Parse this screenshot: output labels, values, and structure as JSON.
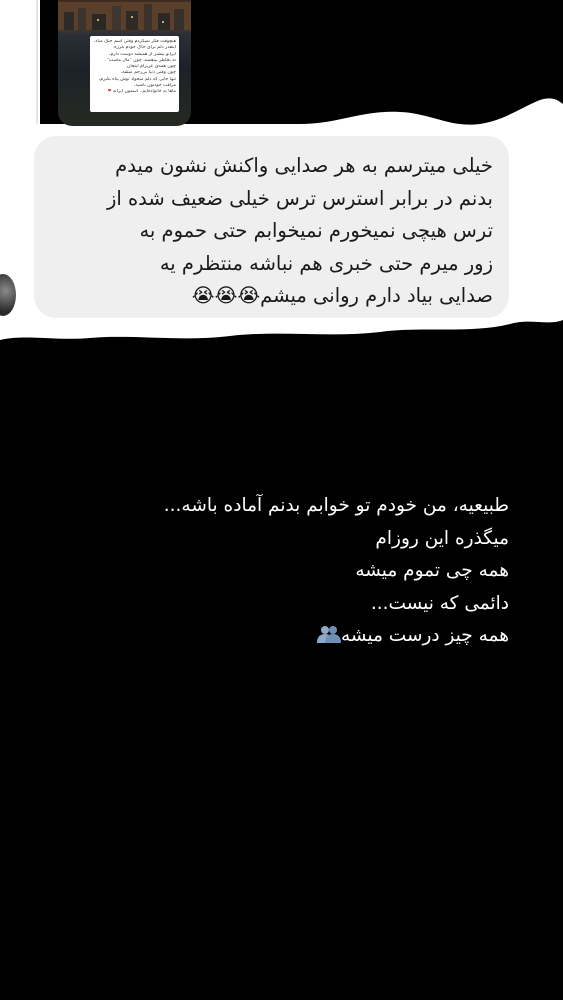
{
  "story_thumbnail": {
    "card_lines": [
      "هیچوقت فکر نمیکردم وقتی اسم جنگ میاد،",
      "اینقدر دلم برای خاک خودم بلرزه.",
      "ایرانو بیشتر از همیشه دوست دارم،",
      "نه بخاطر بینقصه، چون \"مال ماست\".",
      "چون همه‌ی عزیزام اینجان.",
      "چون وقتی دنیا بی‌رحم میشه،",
      "تنها جایی که دلم میخواد توش پناه بگیرم،",
      "مراقب خودتون باشید،",
      "ماها یه خانواده‌ایم.. آسمون ایرانه"
    ],
    "heart": "❤"
  },
  "reply_bubble": {
    "lines": [
      "خیلی میترسم به هر صدایی واکنش نشون میدم",
      "بدنم در برابر استرس ترس خیلی ضعیف شده از",
      "ترس هیچی نمیخورم نمیخوابم حتی حموم به",
      "زور میرم حتی خبری هم نباشه منتظرم یه",
      "صدایی بیاد دارم روانی میشم"
    ],
    "emoji": "😭😭😭"
  },
  "story_caption": {
    "lines": [
      "طبیعیه، من خودم تو خوابم بدنم آماده باشه...",
      "میگذره این روزام",
      "همه چی تموم میشه",
      "دائمی که نیست...",
      "همه چیز درست میشه"
    ],
    "icon": "people-silhouette-icon"
  },
  "colors": {
    "background": "#000000",
    "paper": "#ffffff",
    "bubble": "#efefef",
    "caption_text": "#ffffff",
    "icon_blue": "#8fa8c8"
  }
}
